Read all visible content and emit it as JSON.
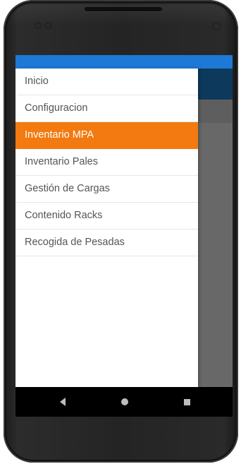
{
  "drawer": {
    "items": [
      {
        "label": "Inicio"
      },
      {
        "label": "Configuracion"
      },
      {
        "label": "Inventario MPA"
      },
      {
        "label": "Inventario Pales"
      },
      {
        "label": "Gestión de Cargas"
      },
      {
        "label": "Contenido Racks"
      },
      {
        "label": "Recogida de Pesadas"
      }
    ],
    "selected_label": "Inventario MPA"
  },
  "nav_bar": {
    "back_icon": "back-triangle-icon",
    "home_icon": "home-circle-icon",
    "recents_icon": "recents-square-icon"
  },
  "colors": {
    "status_bar": "#1e79d6",
    "app_toolbar": "#0d3a5c",
    "active_item": "#f27a10",
    "scrim": "#686868"
  }
}
